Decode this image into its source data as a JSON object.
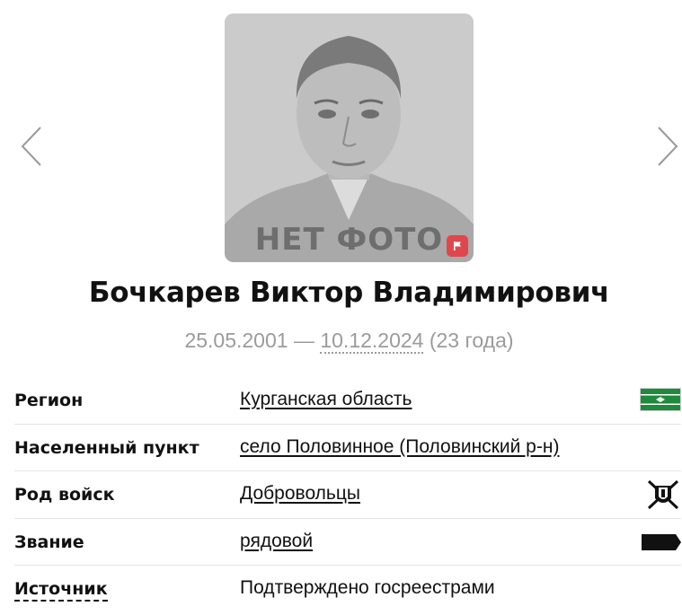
{
  "photo": {
    "caption": "НЕТ ФОТО"
  },
  "person": {
    "name": "Бочкарев Виктор Владимирович",
    "birth_date": "25.05.2001",
    "separator": " — ",
    "death_date": "10.12.2024",
    "age": " (23 года)"
  },
  "info": {
    "region": {
      "label": "Регион",
      "value": "Курганская область"
    },
    "settlement": {
      "label": "Населенный пункт",
      "value": "село Половинное (Половинский р-н)"
    },
    "branch": {
      "label": "Род войск",
      "value": "Добровольцы"
    },
    "rank": {
      "label": "Звание",
      "value": "рядовой"
    },
    "source": {
      "label": "Источник",
      "value": "Подтверждено госреестрами"
    }
  },
  "colors": {
    "flag_button": "#e0474c",
    "region_flag_green": "#1f8a3c",
    "muted_text": "#9b9b9b"
  },
  "icons": {
    "prev": "chevron-left-icon",
    "next": "chevron-right-icon",
    "report": "flag-icon",
    "region": "region-flag-icon",
    "branch": "volunteers-emblem-icon",
    "rank": "shoulder-strap-icon"
  }
}
